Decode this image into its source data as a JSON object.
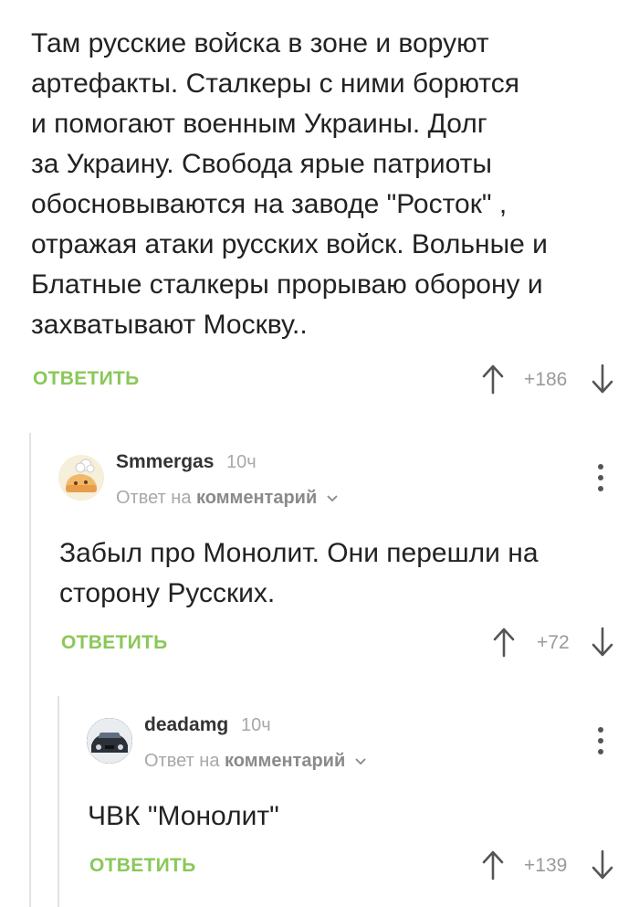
{
  "comment1": {
    "lines": [
      "Там русские войска в зоне и воруют",
      "артефакты. Сталкеры с ними борются",
      "и помогают военным Украины. Долг",
      "за Украину. Свобода ярые патриоты",
      "обосновываются на заводе \"Росток\" ,",
      "отражая атаки русских войск. Вольные и",
      "Блатные сталкеры прорываю оборону и",
      "захватывают Москву.."
    ],
    "reply_label": "ОТВЕТИТЬ",
    "rating": "+186"
  },
  "comment2": {
    "username": "Smmergas",
    "time": "10ч",
    "meta_prefix": "Ответ на",
    "meta_link": "комментарий",
    "lines": [
      "Забыл про Монолит. Они перешли на",
      "сторону Русских."
    ],
    "reply_label": "ОТВЕТИТЬ",
    "rating": "+72"
  },
  "comment3": {
    "username": "deadamg",
    "time": "10ч",
    "meta_prefix": "Ответ на",
    "meta_link": "комментарий",
    "lines": [
      "ЧВК \"Монолит\""
    ],
    "reply_label": "ОТВЕТИТЬ",
    "rating": "+139"
  },
  "colors": {
    "reply": "#8ac858",
    "thread_line": "#e3e3e3",
    "muted": "#a8a8a8"
  },
  "icons": {
    "up": "arrow-up-icon",
    "down": "arrow-down-icon",
    "more": "more-vertical-icon"
  }
}
